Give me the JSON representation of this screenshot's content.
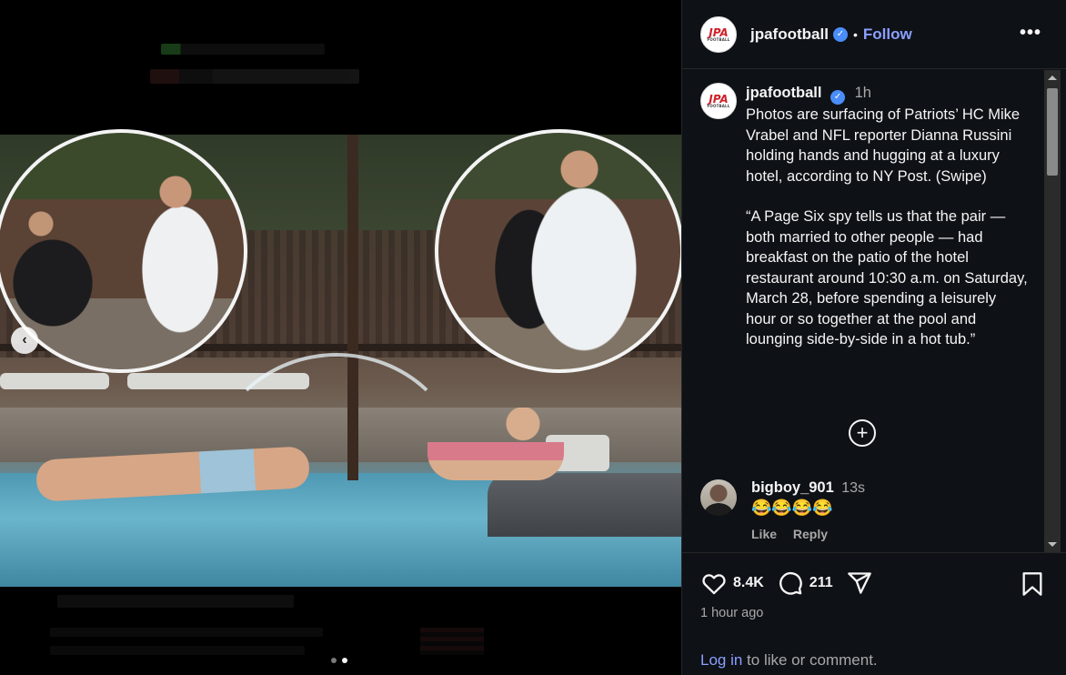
{
  "post": {
    "username": "jpafootball",
    "follow_label": "Follow",
    "separator": "•",
    "more_label": "•••",
    "avatar_logo": "JPA",
    "avatar_sub": "FOOTBALL",
    "verified_glyph": "✓"
  },
  "caption": {
    "username": "jpafootball",
    "time": "1h",
    "paragraphs": [
      "Photos are surfacing of Patriots’ HC Mike Vrabel and NFL reporter Dianna Russini holding hands and hugging at a luxury hotel, according to NY Post. (Swipe)",
      "“A Page Six spy tells us that the pair — both married to other people — had breakfast on the patio of the hotel restaurant around 10:30 a.m. on Saturday, March 28, before spending a leisurely hour or so together at the pool and lounging side-by-side in a hot tub.”"
    ],
    "load_more_icon": "plus-circle-icon"
  },
  "comments": [
    {
      "username": "bigboy_901",
      "time": "13s",
      "text": "😂😂😂😂",
      "like_label": "Like",
      "reply_label": "Reply"
    }
  ],
  "actions": {
    "likes": "8.4K",
    "comments": "211",
    "posted": "1 hour ago",
    "login_link": "Log in",
    "login_rest": " to like or comment."
  },
  "carousel": {
    "prev_glyph": "‹",
    "slides": 2,
    "active": 2
  },
  "colors": {
    "accent": "#8b9fff",
    "verified": "#4a8df8",
    "panel_bg": "#0e1116"
  }
}
